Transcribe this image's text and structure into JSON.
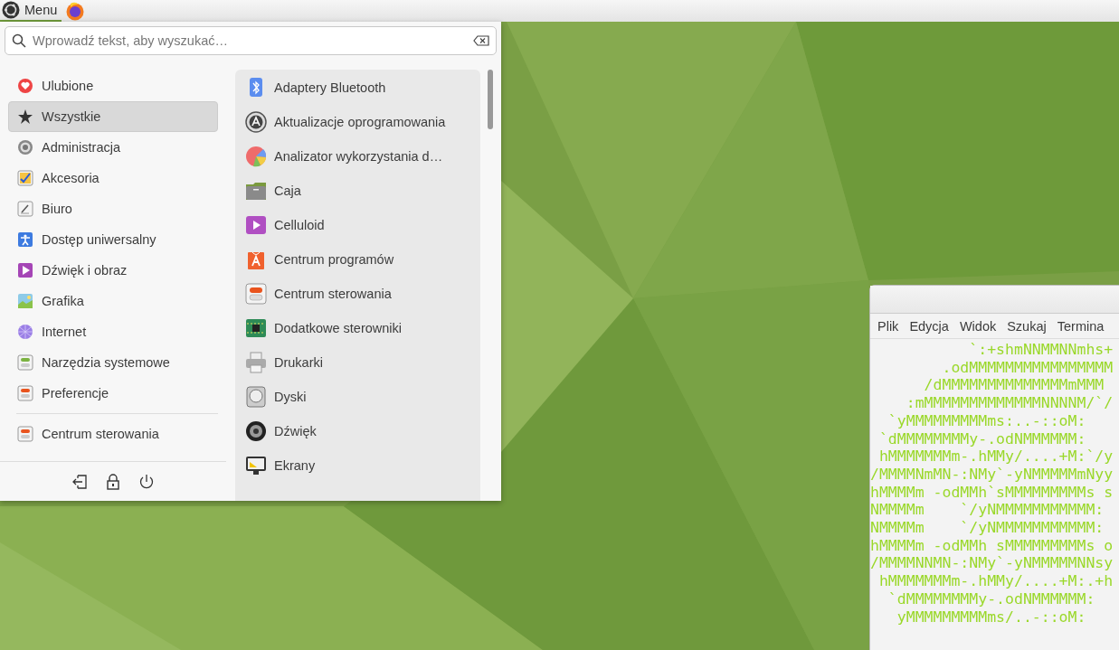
{
  "top_panel": {
    "menu_label": "Menu"
  },
  "menu": {
    "search": {
      "placeholder": "Wprowadź tekst, aby wyszukać…"
    },
    "categories": [
      {
        "label": "Ulubione",
        "selected": false
      },
      {
        "label": "Wszystkie",
        "selected": true
      },
      {
        "label": "Administracja",
        "selected": false
      },
      {
        "label": "Akcesoria",
        "selected": false
      },
      {
        "label": "Biuro",
        "selected": false
      },
      {
        "label": "Dostęp uniwersalny",
        "selected": false
      },
      {
        "label": "Dźwięk i obraz",
        "selected": false
      },
      {
        "label": "Grafika",
        "selected": false
      },
      {
        "label": "Internet",
        "selected": false
      },
      {
        "label": "Narzędzia systemowe",
        "selected": false
      },
      {
        "label": "Preferencje",
        "selected": false
      }
    ],
    "pinned": [
      {
        "label": "Centrum sterowania"
      }
    ],
    "apps": [
      {
        "label": "Adaptery Bluetooth"
      },
      {
        "label": "Aktualizacje oprogramowania"
      },
      {
        "label": "Analizator wykorzystania d…"
      },
      {
        "label": "Caja"
      },
      {
        "label": "Celluloid"
      },
      {
        "label": "Centrum programów"
      },
      {
        "label": "Centrum sterowania"
      },
      {
        "label": "Dodatkowe sterowniki"
      },
      {
        "label": "Drukarki"
      },
      {
        "label": "Dyski"
      },
      {
        "label": "Dźwięk"
      },
      {
        "label": "Ekrany"
      }
    ]
  },
  "terminal": {
    "menu": [
      "Plik",
      "Edycja",
      "Widok",
      "Szukaj",
      "Termina"
    ],
    "lines": [
      "           `:+shmNNMMNNmhs+",
      "        .odMMMMMMMMMMMMMMMM",
      "      /dMMMMMMMMMMMMMMmMMM",
      "    :mMMMMMMMMMMMMMNNNNM/`/",
      "  `yMMMMMMMMMms:..-::oM:",
      " `dMMMMMMMMy-.odNMMMMMM:",
      " hMMMMMMMm-.hMMy/....+M:`/y",
      "/MMMMNmMN-:NMy`-yNMMMMMmNyy",
      "hMMMMm -odMMh`sMMMMMMMMMs s",
      "NMMMMm    `/yNMMMMMMMMMMM:",
      "NMMMMm    `/yNMMMMMMMMMMM:",
      "hMMMMm -odMMh sMMMMMMMMMs o",
      "/MMMMNNMN-:NMy`-yNMMMMMNNsy",
      " hMMMMMMMm-.hMMy/....+M:.+h",
      "  `dMMMMMMMMy-.odNMMMMMM:",
      "   yMMMMMMMMMms/..-::oM:"
    ]
  }
}
